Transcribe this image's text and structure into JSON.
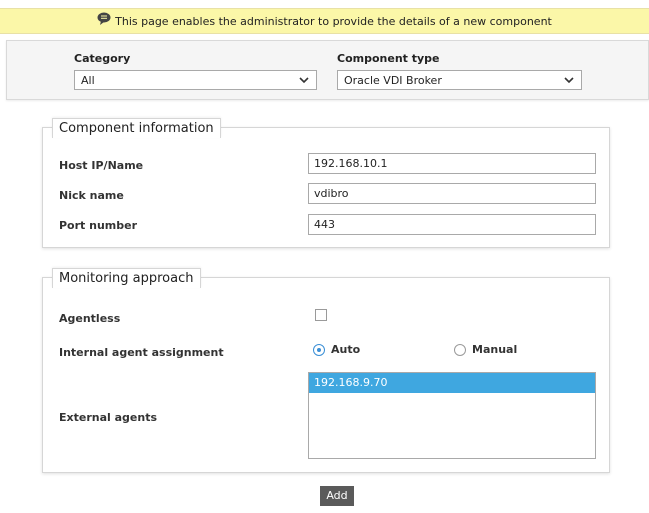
{
  "banner": {
    "icon": "speech-bubble-icon",
    "message": "This page enables the administrator to provide the details of a new component"
  },
  "filters": {
    "category_label": "Category",
    "category_value": "All",
    "component_type_label": "Component type",
    "component_type_value": "Oracle VDI Broker"
  },
  "component_info": {
    "legend": "Component information",
    "host_label": "Host IP/Name",
    "host_value": "192.168.10.1",
    "nick_label": "Nick name",
    "nick_value": "vdibro",
    "port_label": "Port number",
    "port_value": "443"
  },
  "monitoring": {
    "legend": "Monitoring approach",
    "agentless_label": "Agentless",
    "agentless_checked": false,
    "internal_label": "Internal agent assignment",
    "auto_label": "Auto",
    "manual_label": "Manual",
    "selected_assignment": "Auto",
    "external_label": "External agents",
    "external_agents": [
      "192.168.9.70"
    ]
  },
  "actions": {
    "add_label": "Add"
  },
  "colors": {
    "banner": "#fbf7a8",
    "selection": "#3fa7e0",
    "radio_accent": "#3a8fd6",
    "button": "#5a5a5a"
  }
}
